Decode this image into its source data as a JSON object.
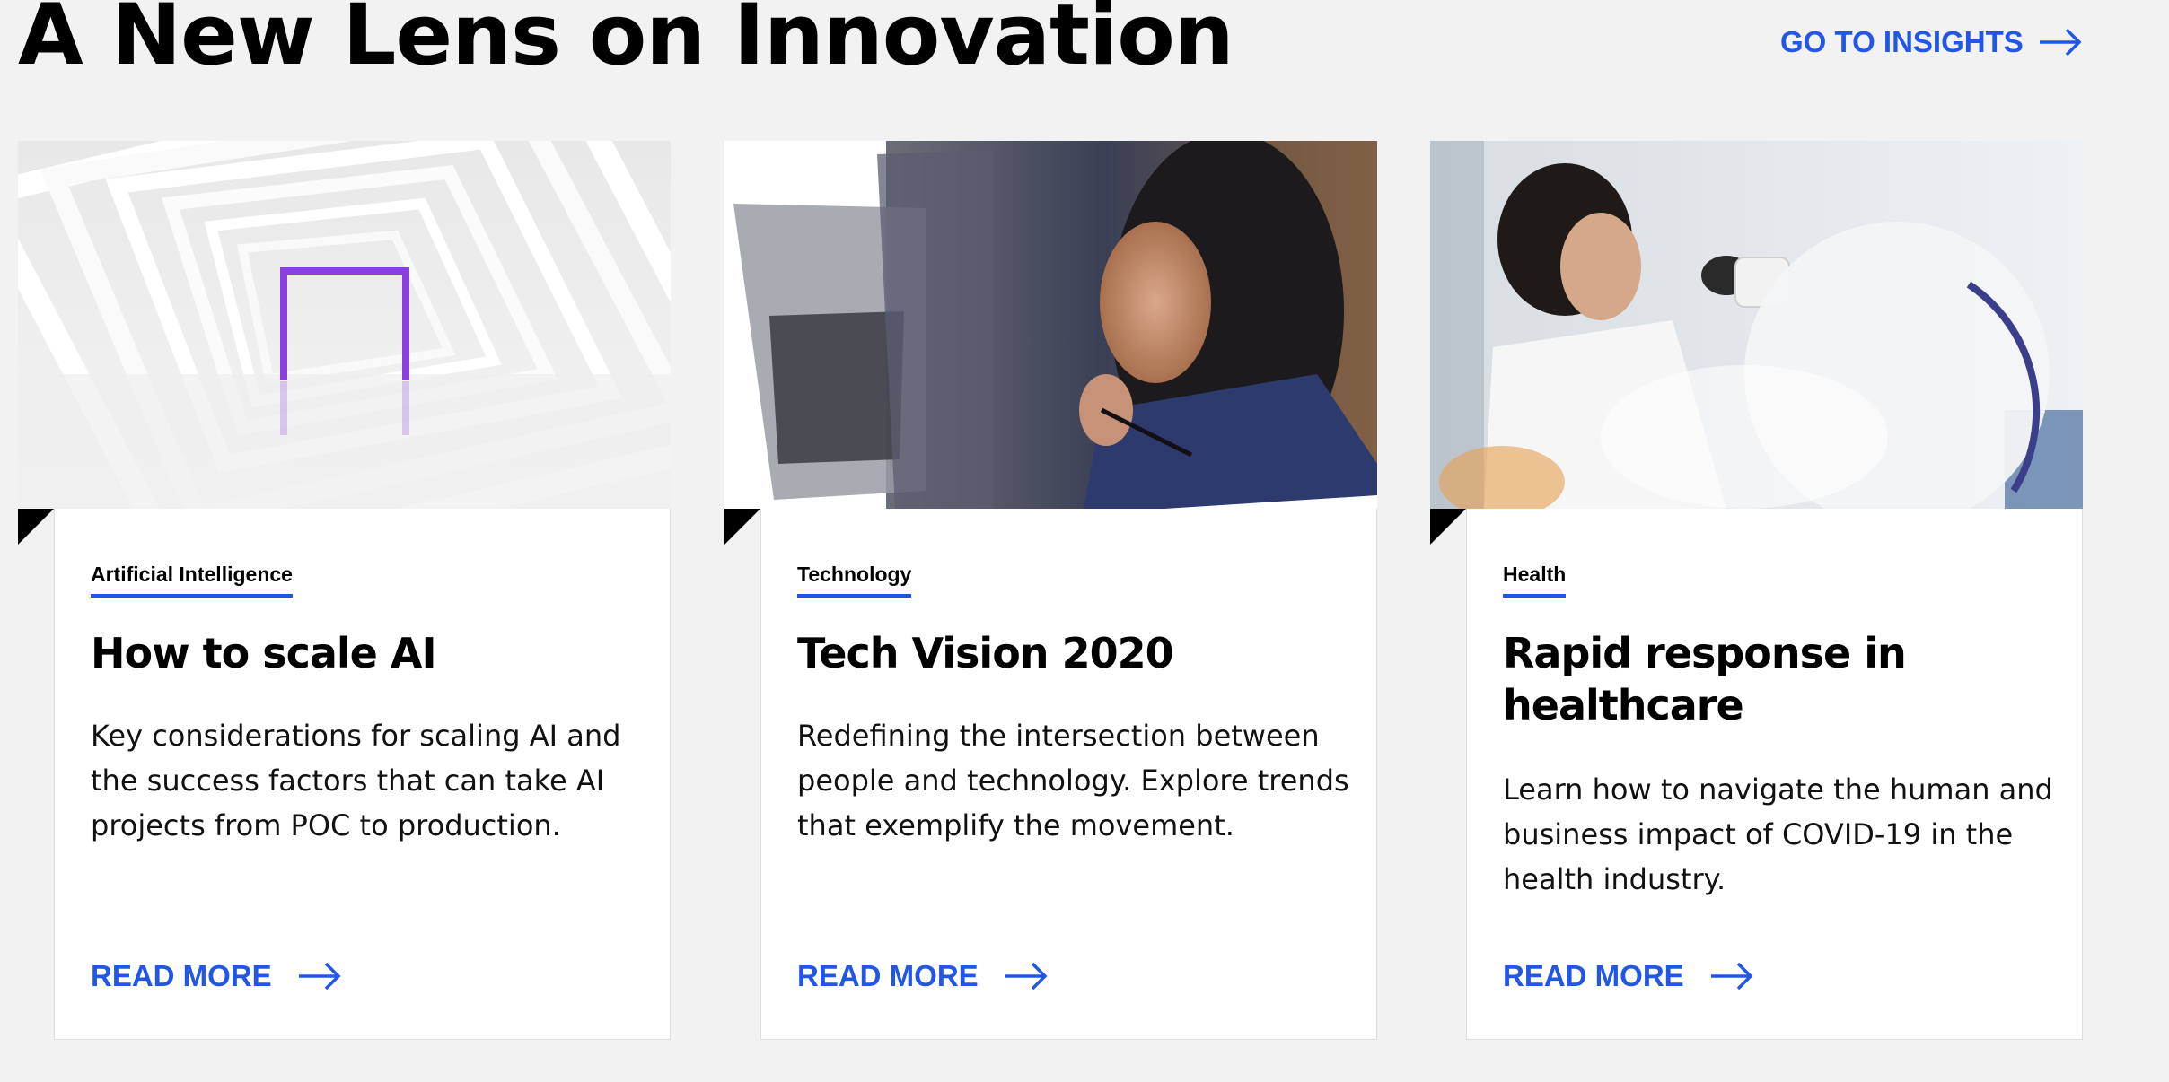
{
  "header": {
    "title": "A New Lens on Innovation",
    "insights_link": "GO TO INSIGHTS"
  },
  "colors": {
    "accent": "#2156e6",
    "background": "#f2f2f2",
    "card": "#ffffff",
    "text": "#000000"
  },
  "cards": [
    {
      "tag": "Artificial Intelligence",
      "title": "How to scale AI",
      "description": "Key considerations for scaling AI and the success factors that can take AI projects from POC to production.",
      "cta": "READ MORE",
      "image": "white-tunnel-purple-frame"
    },
    {
      "tag": "Technology",
      "title": "Tech Vision 2020",
      "description": "Redefining the intersection between people and technology. Explore trends that exemplify the movement.",
      "cta": "READ MORE",
      "image": "woman-speaking-collage"
    },
    {
      "tag": "Health",
      "title": "Rapid response in healthcare",
      "description": "Learn how to navigate the human and business impact of COVID-19 in the health industry.",
      "cta": "READ MORE",
      "image": "scientist-microscope"
    }
  ]
}
